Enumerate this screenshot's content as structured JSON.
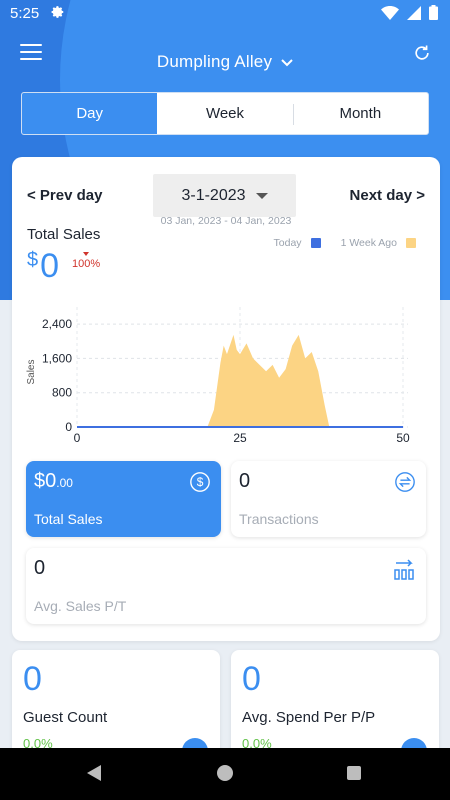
{
  "status_bar": {
    "time": "5:25",
    "icons": [
      "gear-icon",
      "wifi-icon",
      "signal-icon",
      "battery-icon"
    ]
  },
  "header": {
    "menu_icon": "hamburger-menu-icon",
    "store_name": "Dumpling Alley",
    "refresh_icon": "refresh-icon"
  },
  "period_tabs": [
    {
      "label": "Day",
      "active": true
    },
    {
      "label": "Week",
      "active": false
    },
    {
      "label": "Month",
      "active": false
    }
  ],
  "date_nav": {
    "prev_label": "< Prev day",
    "next_label": "Next day >",
    "selected_date": "3-1-2023",
    "range_text": "03 Jan, 2023 - 04 Jan, 2023"
  },
  "total_sales": {
    "label": "Total Sales",
    "currency": "$",
    "value": "0",
    "change_pct": "100%",
    "change_color": "#d0342c"
  },
  "chart_data": {
    "type": "area",
    "xlabel": "",
    "ylabel": "Sales",
    "xlim": [
      0,
      50
    ],
    "ylim": [
      0,
      2800
    ],
    "x_ticks": [
      "0",
      "25",
      "50"
    ],
    "y_ticks": [
      "0",
      "800",
      "1,600",
      "2,400"
    ],
    "grid": true,
    "legend_placement": "top-right",
    "series": [
      {
        "name": "Today",
        "color": "#3e6fe0",
        "x": [
          0,
          50
        ],
        "values": [
          0,
          0
        ]
      },
      {
        "name": "1 Week Ago",
        "color": "#fcd484",
        "x": [
          20,
          21,
          22,
          22.5,
          23,
          24,
          24.5,
          25,
          26,
          27,
          28,
          29,
          30,
          31,
          32,
          33,
          34,
          35,
          36,
          37,
          38,
          38.7
        ],
        "values": [
          0,
          400,
          1500,
          1900,
          1700,
          2150,
          1800,
          1700,
          1950,
          1600,
          1450,
          1300,
          1450,
          1150,
          1350,
          1900,
          2150,
          1600,
          1750,
          1300,
          500,
          0
        ]
      }
    ]
  },
  "tiles": {
    "total_sales": {
      "value_main": "$0",
      "value_cents": ".00",
      "label": "Total Sales",
      "icon": "dollar-circle-icon"
    },
    "transactions": {
      "value": "0",
      "label": "Transactions",
      "icon": "exchange-icon"
    },
    "avg_sales": {
      "value": "0",
      "label": "Avg. Sales P/T",
      "icon": "arrow-bars-icon"
    }
  },
  "bottom_cards": [
    {
      "value": "0",
      "label": "Guest Count",
      "pct": "0.0%"
    },
    {
      "value": "0",
      "label": "Avg. Spend Per P/P",
      "pct": "0.0%"
    }
  ],
  "colors": {
    "accent": "#3b8ef0",
    "header": "#2f7ae0",
    "positive": "#63c24a"
  }
}
